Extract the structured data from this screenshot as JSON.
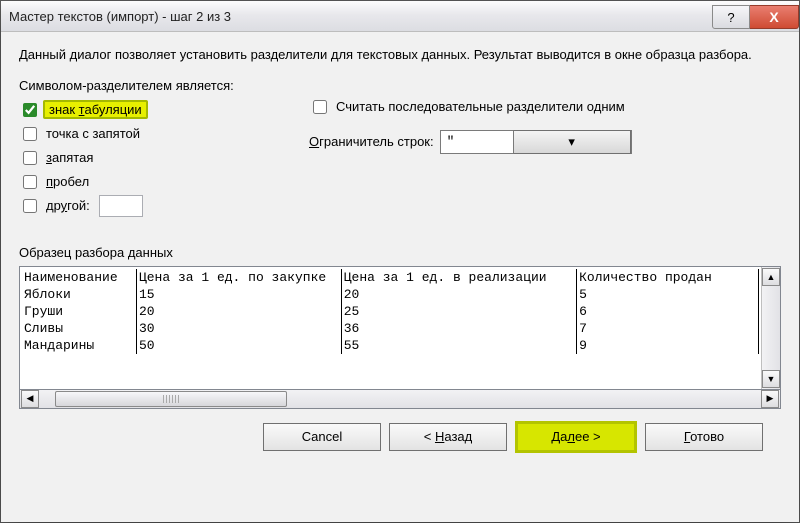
{
  "title": "Мастер текстов (импорт) - шаг 2 из 3",
  "intro": "Данный диалог позволяет установить разделители для текстовых данных. Результат выводится в окне образца разбора.",
  "delim_group_label": "Символом-разделителем является:",
  "delims": {
    "tab": {
      "label": "знак табуляции",
      "checked": true,
      "highlight": true,
      "accesskey_index": 5
    },
    "semicolon": {
      "label": "точка с запятой",
      "checked": false
    },
    "comma": {
      "label": "запятая",
      "checked": false,
      "accesskey_index": 0
    },
    "space": {
      "label": "пробел",
      "checked": false,
      "accesskey_index": 0
    },
    "other": {
      "label": "другой:",
      "checked": false,
      "accesskey_index": 2,
      "value": ""
    }
  },
  "treat_consecutive": {
    "label": "Считать последовательные разделители одним",
    "checked": false
  },
  "qualifier": {
    "label": "Ограничитель строк:",
    "value": "\"",
    "accesskey_index": 0
  },
  "preview_label": "Образец разбора данных",
  "preview": {
    "headers": [
      "Наименование",
      "Цена за 1 ед. по закупке",
      "Цена за 1 ед. в реализации",
      "Количество продан"
    ],
    "rows": [
      [
        "Яблоки",
        "15",
        "20",
        "5"
      ],
      [
        "Груши",
        "20",
        "25",
        "6"
      ],
      [
        "Сливы",
        "30",
        "36",
        "7"
      ],
      [
        "Мандарины",
        "50",
        "55",
        "9"
      ]
    ]
  },
  "buttons": {
    "cancel": "Cancel",
    "back": "< Назад",
    "next": "Далее >",
    "finish": "Готово"
  },
  "titlebar_controls": {
    "help": "?",
    "close": "X"
  }
}
